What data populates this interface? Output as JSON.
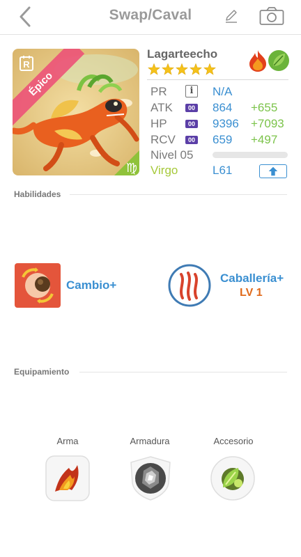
{
  "header": {
    "title": "Swap/Caval"
  },
  "card": {
    "rarity_label": "Épico",
    "name": "Lagarteecho",
    "star_count": 5,
    "elements": [
      "fire-element-icon",
      "leaf-element-icon"
    ],
    "stats": [
      {
        "label": "PR",
        "value": "N/A",
        "plus": ""
      },
      {
        "label": "ATK",
        "badge": "00",
        "value": "864",
        "plus": "+655"
      },
      {
        "label": "HP",
        "badge": "00",
        "value": "9396",
        "plus": "+7093"
      },
      {
        "label": "RCV",
        "badge": "00",
        "value": "659",
        "plus": "+497"
      }
    ],
    "level_label": "Nivel 05",
    "level_progress": 0,
    "sign": "Virgo",
    "level_cap": "L61",
    "colors": {
      "accent_blue": "#3a8fd1",
      "plus_green": "#7bc34a",
      "sign_green": "#a6c93a",
      "epic_pink": "#ec5278"
    }
  },
  "skills": {
    "section_title": "Habilidades",
    "active": {
      "label": "Cambio+",
      "icon": "swap-seed-icon"
    },
    "leader": {
      "label": "Caballería+",
      "level": "LV 1",
      "icon": "claw-marks-icon"
    }
  },
  "equipment": {
    "section_title": "Equipamiento",
    "slots": [
      {
        "label": "Arma",
        "icon": "fire-weapon-icon"
      },
      {
        "label": "Armadura",
        "icon": "stone-armor-icon"
      },
      {
        "label": "Accesorio",
        "icon": "leaf-accessory-icon"
      }
    ]
  }
}
